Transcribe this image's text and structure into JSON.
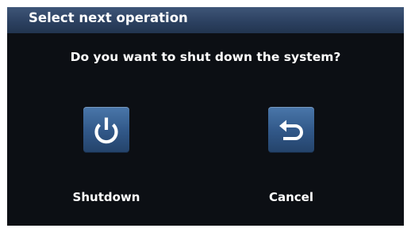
{
  "dialog": {
    "title": "Select next operation",
    "question": "Do you want to shut down the system?",
    "buttons": [
      {
        "id": "shutdown",
        "label": "Shutdown",
        "icon": "power-icon"
      },
      {
        "id": "cancel",
        "label": "Cancel",
        "icon": "return-arrow-icon"
      }
    ]
  },
  "colors": {
    "dialog_background": "#0c0f14",
    "titlebar": "#2c4161",
    "button": "#32598a",
    "text": "#ffffff"
  }
}
